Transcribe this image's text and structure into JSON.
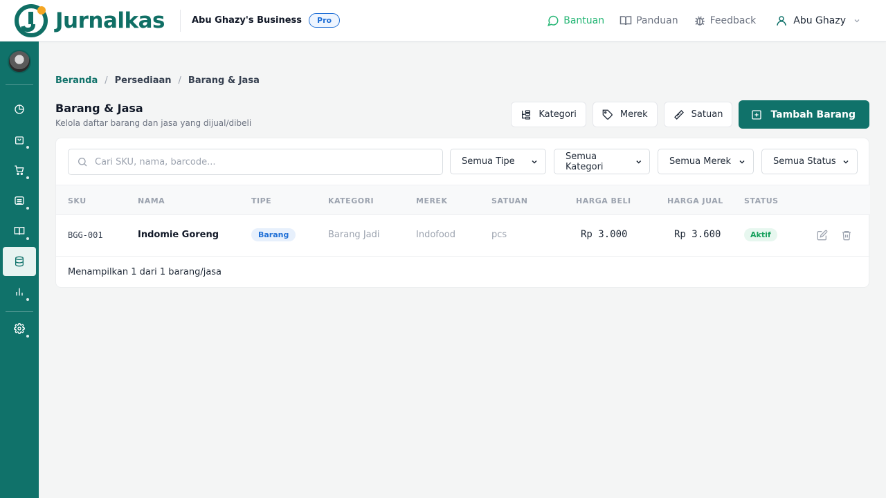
{
  "app": {
    "name": "Jurnalkas",
    "business": "Abu Ghazy's Business",
    "plan_badge": "Pro"
  },
  "topnav": {
    "help": "Bantuan",
    "guide": "Panduan",
    "feedback": "Feedback",
    "user": "Abu Ghazy"
  },
  "sidebar": {
    "items": [
      {
        "name": "dashboard",
        "icon": "pie-chart-icon"
      },
      {
        "name": "sales",
        "icon": "shopping-bag-icon"
      },
      {
        "name": "purchases",
        "icon": "shopping-cart-icon"
      },
      {
        "name": "cash-bank",
        "icon": "bank-icon"
      },
      {
        "name": "accounting",
        "icon": "book-icon"
      },
      {
        "name": "inventory",
        "icon": "database-icon",
        "active": true
      },
      {
        "name": "reports",
        "icon": "bar-chart-icon"
      },
      {
        "name": "settings",
        "icon": "gear-icon"
      }
    ]
  },
  "breadcrumb": {
    "home": "Beranda",
    "section": "Persediaan",
    "current": "Barang & Jasa"
  },
  "page": {
    "title": "Barang & Jasa",
    "subtitle": "Kelola daftar barang dan jasa yang dijual/dibeli"
  },
  "actions": {
    "category": "Kategori",
    "brand": "Merek",
    "unit": "Satuan",
    "add": "Tambah Barang"
  },
  "filters": {
    "search_placeholder": "Cari SKU, nama, barcode...",
    "type": "Semua Tipe",
    "category": "Semua Kategori",
    "brand": "Semua Merek",
    "status": "Semua Status"
  },
  "table": {
    "headers": [
      "SKU",
      "NAMA",
      "TIPE",
      "KATEGORI",
      "MEREK",
      "SATUAN",
      "HARGA BELI",
      "HARGA JUAL",
      "STATUS"
    ],
    "rows": [
      {
        "sku": "BGG-001",
        "name": "Indomie Goreng",
        "type": "Barang",
        "category": "Barang Jadi",
        "brand": "Indofood",
        "unit": "pcs",
        "buy_price": "Rp 3.000",
        "sell_price": "Rp 3.600",
        "status": "Aktif"
      }
    ]
  },
  "footer": {
    "summary": "Menampilkan 1 dari 1 barang/jasa"
  },
  "colors": {
    "brand": "#10726a",
    "accent_orange": "#f5a623",
    "help_green": "#22b573",
    "badge_blue": "#1f6fd6"
  }
}
